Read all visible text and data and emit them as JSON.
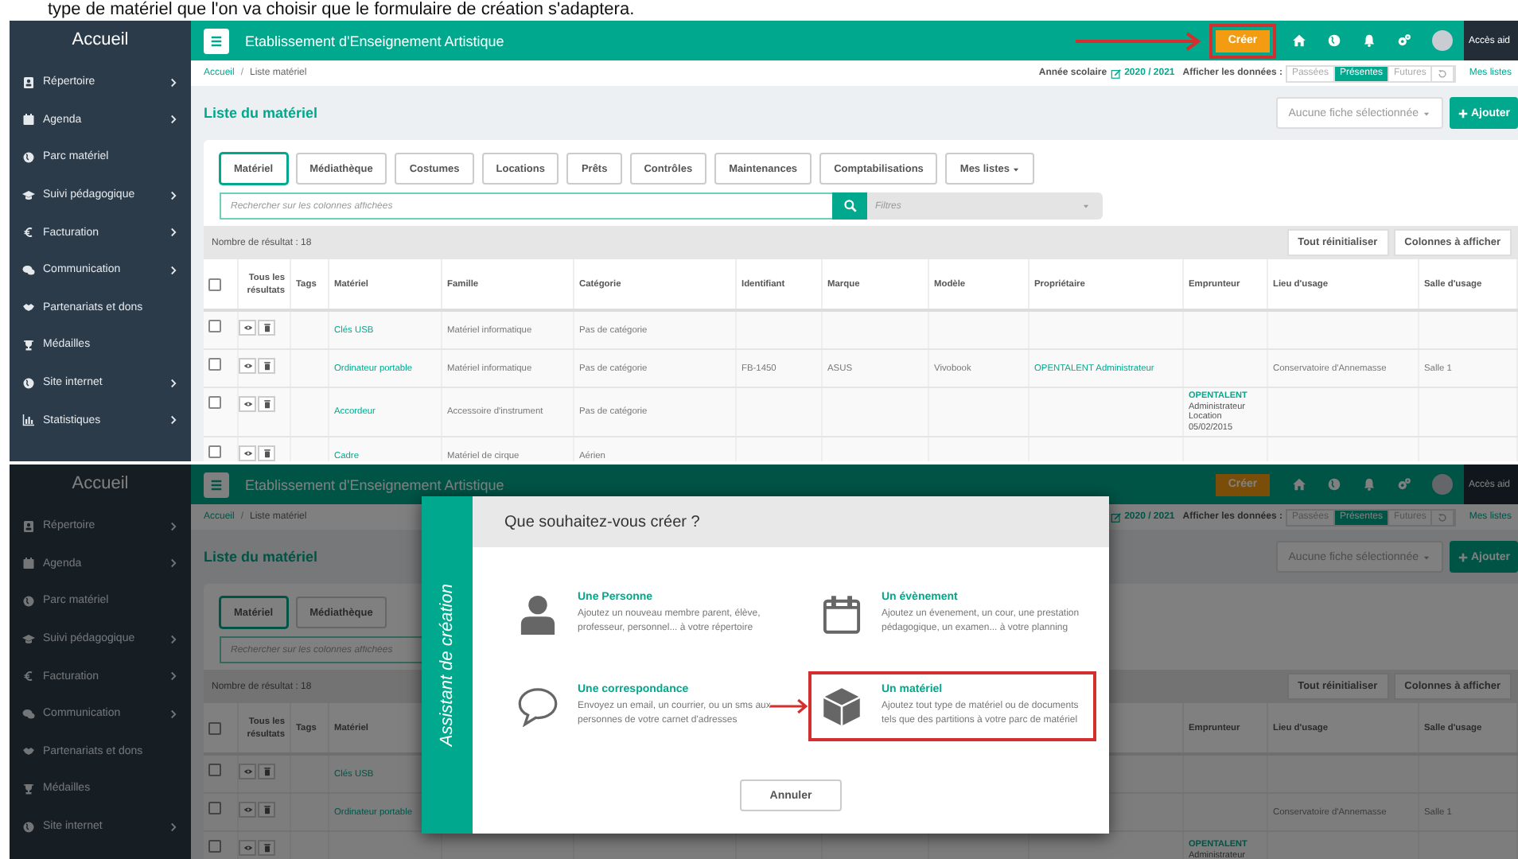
{
  "caption": "type de matériel que l'on va choisir que le formulaire de création s'adaptera.",
  "screens": [
    {
      "sidebar": {
        "title": "Accueil",
        "items": [
          {
            "label": "Répertoire",
            "submenu": true
          },
          {
            "label": "Agenda",
            "submenu": true
          },
          {
            "label": "Parc matériel",
            "submenu": false
          },
          {
            "label": "Suivi pédagogique",
            "submenu": true
          },
          {
            "label": "Facturation",
            "submenu": true
          },
          {
            "label": "Communication",
            "submenu": true
          },
          {
            "label": "Partenariats et dons",
            "submenu": false
          },
          {
            "label": "Médailles",
            "submenu": false
          },
          {
            "label": "Site internet",
            "submenu": true
          },
          {
            "label": "Statistiques",
            "submenu": true
          }
        ]
      },
      "header": {
        "title": "Etablissement d'Enseignement Artistique",
        "create_button": {
          "label": "Créer",
          "highlighted": true
        },
        "help_link": "Accès aid"
      },
      "toolbar": {
        "breadcrumb": [
          "Accueil",
          "Liste matériel"
        ],
        "breadcrumb_separator": "/",
        "school_year_label": "Année scolaire",
        "school_year": "2020 / 2021",
        "display_label": "Afficher les données :",
        "display_options": [
          {
            "label": "Passées",
            "selected": false
          },
          {
            "label": "Présentes",
            "selected": true
          },
          {
            "label": "Futures",
            "selected": false
          }
        ],
        "my_lists": "Mes listes"
      },
      "page_title": "Liste du matériel",
      "selection_dropdown": "Aucune fiche sélectionnée",
      "add_button": "Ajouter",
      "tabs": [
        {
          "label": "Matériel",
          "selected": true,
          "kind": "tab"
        },
        {
          "label": "Médiathèque",
          "selected": false,
          "kind": "tab"
        },
        {
          "label": "Costumes",
          "selected": false,
          "kind": "tab"
        },
        {
          "label": "Locations",
          "selected": false,
          "kind": "tab"
        },
        {
          "label": "Prêts",
          "selected": false,
          "kind": "tab"
        },
        {
          "label": "Contrôles",
          "selected": false,
          "kind": "tab"
        },
        {
          "label": "Maintenances",
          "selected": false,
          "kind": "tab"
        },
        {
          "label": "Comptabilisations",
          "selected": false,
          "kind": "tab"
        },
        {
          "label": "Mes listes",
          "selected": false,
          "kind": "dropdown"
        }
      ],
      "search": {
        "placeholder": "Rechercher sur les colonnes affichées"
      },
      "filters": {
        "placeholder": "Filtres"
      },
      "result_count": "Nombre de résultat : 18",
      "reset_button": "Tout réinitialiser",
      "columns_button": "Colonnes à afficher",
      "table": {
        "select_all": {
          "checked": false
        },
        "actions_label": "Tous les résultats",
        "columns": [
          {
            "label": "Tags"
          },
          {
            "label": "Matériel",
            "kind": "link"
          },
          {
            "label": "Famille",
            "kind": "text"
          },
          {
            "label": "Catégorie",
            "kind": "text"
          },
          {
            "label": "Identifiant",
            "kind": "text"
          },
          {
            "label": "Marque",
            "kind": "text"
          },
          {
            "label": "Modèle",
            "kind": "text"
          },
          {
            "label": "Propriétaire",
            "kind": "link"
          },
          {
            "label": "Emprunteur"
          },
          {
            "label": "Lieu d'usage",
            "kind": "text"
          },
          {
            "label": "Salle d'usage",
            "kind": "text"
          }
        ],
        "rows": [
          {
            "checked": false,
            "cells": [
              null,
              "Clés USB",
              "Matériel informatique",
              "Pas de catégorie",
              null,
              null,
              null,
              null,
              null,
              null,
              null
            ]
          },
          {
            "checked": false,
            "cells": [
              null,
              "Ordinateur portable",
              "Matériel informatique",
              "Pas de catégorie",
              "FB-1450",
              "ASUS",
              "Vivobook",
              "OPENTALENT Administrateur",
              null,
              "Conservatoire d'Annemasse",
              "Salle 1"
            ]
          },
          {
            "checked": false,
            "cells": [
              null,
              "Accordeur",
              "Accessoire d'instrument",
              "Pas de catégorie",
              null,
              null,
              null,
              null,
              {
                "name": "OPENTALENT",
                "role": "Administrateur",
                "type": "Location",
                "date": "05/02/2015"
              },
              null,
              null
            ]
          },
          {
            "checked": false,
            "cells": [
              null,
              "Cadre",
              "Matériel de cirque",
              "Aérien",
              null,
              null,
              null,
              null,
              null,
              null,
              null
            ]
          }
        ]
      }
    },
    {
      "sidebar": {
        "title": "Accueil",
        "items": [
          {
            "label": "Répertoire",
            "submenu": true
          },
          {
            "label": "Agenda",
            "submenu": true
          },
          {
            "label": "Parc matériel",
            "submenu": false
          },
          {
            "label": "Suivi pédagogique",
            "submenu": true
          },
          {
            "label": "Facturation",
            "submenu": true
          },
          {
            "label": "Communication",
            "submenu": true
          },
          {
            "label": "Partenariats et dons",
            "submenu": false
          },
          {
            "label": "Médailles",
            "submenu": false
          },
          {
            "label": "Site internet",
            "submenu": true
          }
        ]
      },
      "header": {
        "title": "Etablissement d'Enseignement Artistique",
        "create_button": {
          "label": "Créer",
          "highlighted": false
        },
        "help_link": "Accès aid"
      },
      "toolbar": {
        "breadcrumb": [
          "Accueil",
          "Liste matériel"
        ],
        "breadcrumb_separator": "/",
        "school_year": "2020 / 2021",
        "display_label": "Afficher les données :",
        "display_options": [
          {
            "label": "Passées",
            "selected": false
          },
          {
            "label": "Présentes",
            "selected": true
          },
          {
            "label": "Futures",
            "selected": false
          }
        ],
        "my_lists": "Mes listes"
      },
      "page_title": "Liste du matériel",
      "selection_dropdown": "Aucune fiche sélectionnée",
      "add_button": "Ajouter",
      "tabs": [
        {
          "label": "Matériel",
          "selected": true,
          "kind": "tab"
        },
        {
          "label": "Médiathèque",
          "selected": false,
          "kind": "tab"
        }
      ],
      "search": {
        "placeholder": "Rechercher sur les colonnes affichées"
      },
      "result_count": "Nombre de résultat : 18",
      "reset_button": "Tout réinitialiser",
      "columns_button": "Colonnes à afficher",
      "table": {
        "select_all": {
          "checked": false
        },
        "actions_label": "Tous les résultats",
        "columns": [
          {
            "label": "Tags"
          },
          {
            "label": "Matériel",
            "kind": "link"
          },
          null,
          null,
          null,
          null,
          null,
          null,
          {
            "label": "Emprunteur"
          },
          {
            "label": "Lieu d'usage",
            "kind": "text"
          },
          {
            "label": "Salle d'usage",
            "kind": "text"
          }
        ],
        "rows": [
          {
            "checked": false,
            "cells": [
              null,
              "Clés USB",
              null,
              null,
              null,
              null,
              null,
              null,
              null,
              null,
              null
            ]
          },
          {
            "checked": false,
            "cells": [
              null,
              "Ordinateur portable",
              null,
              null,
              null,
              null,
              null,
              null,
              null,
              "Conservatoire d'Annemasse",
              "Salle 1"
            ]
          },
          {
            "checked": false,
            "cells": [
              null,
              null,
              null,
              null,
              null,
              null,
              null,
              null,
              {
                "name": "OPENTALENT",
                "role": "Administrateur"
              },
              null,
              null
            ]
          }
        ]
      },
      "dialog": {
        "side_title": "Assistant de création",
        "title": "Que souhaitez-vous créer ?",
        "options": [
          {
            "title": "Une Personne",
            "description": "Ajoutez un nouveau membre parent, élève, professeur, personnel... à votre répertoire",
            "highlighted": false
          },
          {
            "title": "Un évènement",
            "description": "Ajoutez un évenement, un cour, une prestation pédagogique, un examen... à votre planning",
            "highlighted": false
          },
          {
            "title": "Une correspondance",
            "description": "Envoyez un email, un courrier, ou un sms aux personnes de votre carnet d'adresses",
            "highlighted": false
          },
          {
            "title": "Un matériel",
            "description": "Ajoutez tout type de matériel ou de documents tels que des partitions à votre parc de matériel",
            "highlighted": true
          }
        ],
        "cancel_button": "Annuler"
      }
    }
  ]
}
